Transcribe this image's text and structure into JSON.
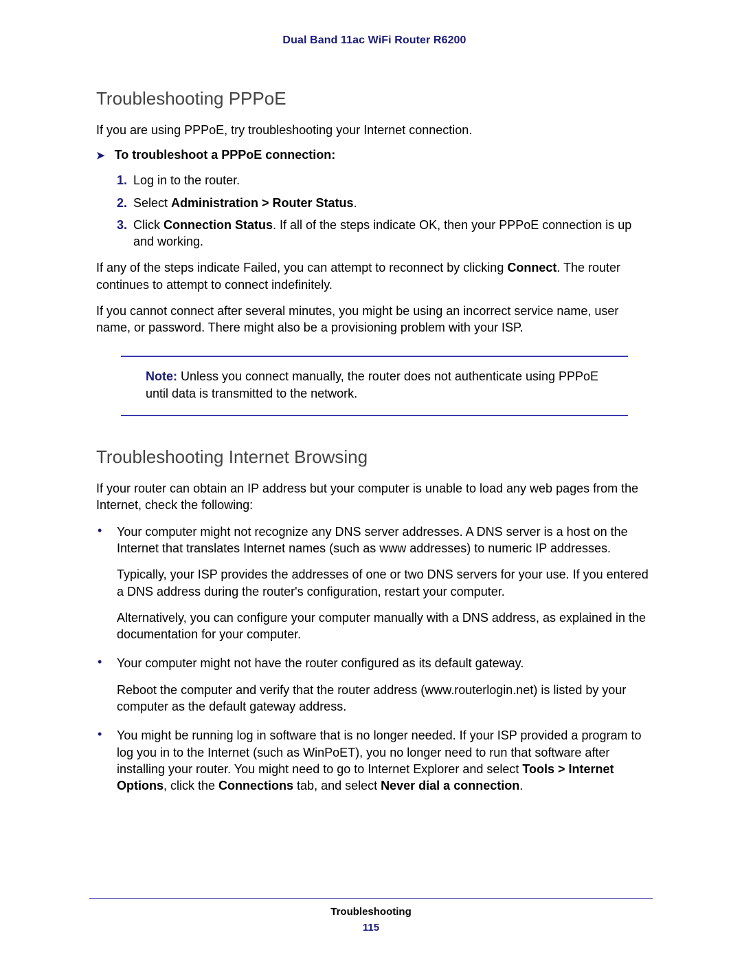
{
  "header": {
    "title": "Dual Band 11ac WiFi Router R6200"
  },
  "sections": {
    "pppoe": {
      "heading": "Troubleshooting PPPoE",
      "intro": "If you are using PPPoE, try troubleshooting your Internet connection.",
      "procedure_title": "To troubleshoot a PPPoE connection:",
      "steps": {
        "s1": "Log in to the router.",
        "s2_prefix": "Select ",
        "s2_bold": "Administration > Router Status",
        "s2_suffix": ".",
        "s3_prefix": "Click ",
        "s3_bold": "Connection Status",
        "s3_suffix": ". If all of the steps indicate OK, then your PPPoE connection is up and working."
      },
      "para1_prefix": "If any of the steps indicate Failed, you can attempt to reconnect by clicking ",
      "para1_bold": "Connect",
      "para1_suffix": ". The router continues to attempt to connect indefinitely.",
      "para2": "If you cannot connect after several minutes, you might be using an incorrect service name, user name, or password. There might also be a provisioning problem with your ISP.",
      "note_label": "Note:  ",
      "note_body": "Unless you connect manually, the router does not authenticate using PPPoE until data is transmitted to the network."
    },
    "browsing": {
      "heading": "Troubleshooting Internet Browsing",
      "intro": "If your router can obtain an IP address but your computer is unable to load any web pages from the Internet, check the following:",
      "bullet1": {
        "p1": "Your computer might not recognize any DNS server addresses. A DNS server is a host on the Internet that translates Internet names (such as www addresses) to numeric IP addresses.",
        "p2": "Typically, your ISP provides the addresses of one or two DNS servers for your use. If you entered a DNS address during the router's configuration, restart your computer.",
        "p3": "Alternatively, you can configure your computer manually with a DNS address, as explained in the documentation for your computer."
      },
      "bullet2": {
        "p1": "Your computer might not have the router configured as its default gateway.",
        "p2": "Reboot the computer and verify that the router address (www.routerlogin.net) is listed by your computer as the default gateway address."
      },
      "bullet3": {
        "p1_a": "You might be running log in software that is no longer needed. If your ISP provided a program to log you in to the Internet (such as WinPoET), you no longer need to run that software after installing your router. You might need to go to Internet Explorer and select ",
        "p1_b1": "Tools > Internet Options",
        "p1_c": ", click the ",
        "p1_b2": "Connections",
        "p1_d": " tab, and select ",
        "p1_b3": "Never dial a connection",
        "p1_e": "."
      }
    }
  },
  "footer": {
    "section": "Troubleshooting",
    "page": "115"
  }
}
